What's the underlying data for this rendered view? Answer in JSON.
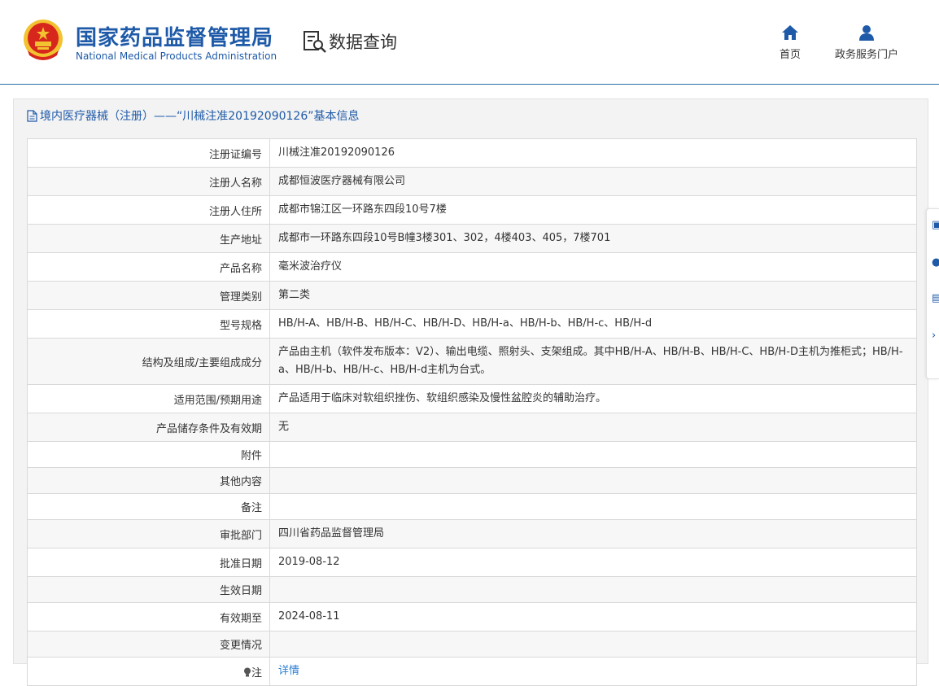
{
  "header": {
    "org_name_cn": "国家药品监督管理局",
    "org_name_en": "National Medical Products Administration",
    "query_label": "数据查询",
    "nav": {
      "home": "首页",
      "gov_portal": "政务服务门户"
    }
  },
  "panel": {
    "title": "境内医疗器械（注册）——“川械注准20192090126”基本信息"
  },
  "rows": [
    {
      "label": "注册证编号",
      "value": "川械注准20192090126"
    },
    {
      "label": "注册人名称",
      "value": "成都恒波医疗器械有限公司"
    },
    {
      "label": "注册人住所",
      "value": "成都市锦江区一环路东四段10号7楼"
    },
    {
      "label": "生产地址",
      "value": "成都市一环路东四段10号B幢3楼301、302，4楼403、405，7楼701"
    },
    {
      "label": "产品名称",
      "value": "毫米波治疗仪"
    },
    {
      "label": "管理类别",
      "value": "第二类"
    },
    {
      "label": "型号规格",
      "value": "HB/H-A、HB/H-B、HB/H-C、HB/H-D、HB/H-a、HB/H-b、HB/H-c、HB/H-d"
    },
    {
      "label": "结构及组成/主要组成成分",
      "value": "产品由主机（软件发布版本：V2）、输出电缆、照射头、支架组成。其中HB/H-A、HB/H-B、HB/H-C、HB/H-D主机为推柜式；HB/H-a、HB/H-b、HB/H-c、HB/H-d主机为台式。"
    },
    {
      "label": "适用范围/预期用途",
      "value": "产品适用于临床对软组织挫伤、软组织感染及慢性盆腔炎的辅助治疗。"
    },
    {
      "label": "产品储存条件及有效期",
      "value": "无"
    },
    {
      "label": "附件",
      "value": ""
    },
    {
      "label": "其他内容",
      "value": ""
    },
    {
      "label": "备注",
      "value": ""
    },
    {
      "label": "审批部门",
      "value": "四川省药品监督管理局"
    },
    {
      "label": "批准日期",
      "value": "2019-08-12"
    },
    {
      "label": "生效日期",
      "value": ""
    },
    {
      "label": "有效期至",
      "value": "2024-08-11"
    },
    {
      "label": "变更情况",
      "value": ""
    },
    {
      "label": "注",
      "value": "详情"
    }
  ],
  "colors": {
    "brand_blue": "#1e5aa8",
    "link_blue": "#2a7ed3",
    "emblem_red": "#d7261c",
    "emblem_gold": "#f2c230"
  }
}
